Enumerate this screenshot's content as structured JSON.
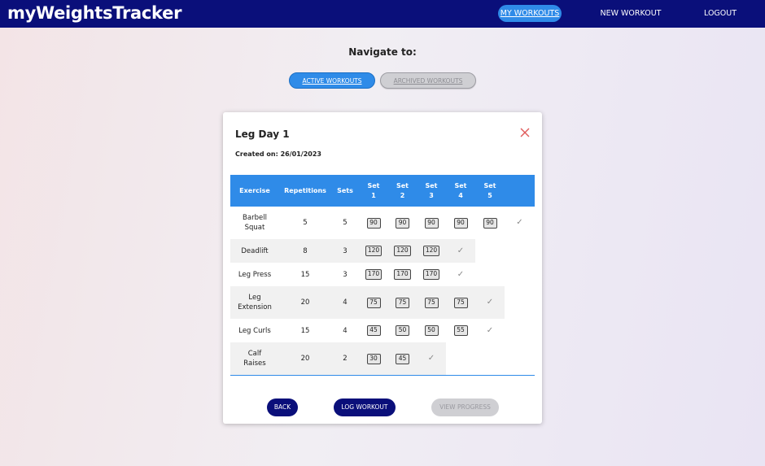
{
  "navbar": {
    "brand": "myWeightsTracker",
    "links": [
      "MY WORKOUTS",
      "NEW WORKOUT",
      "LOGOUT"
    ]
  },
  "navigate": {
    "title": "Navigate to:",
    "active_label": "ACTIVE WORKOUTS",
    "archived_label": "ARCHIVED WORKOUTS"
  },
  "workout": {
    "title": "Leg Day 1",
    "created_label": "Created on:",
    "created_date": "26/01/2023",
    "headers": [
      "Exercise",
      "Repetitions",
      "Sets",
      "Set\n1",
      "Set\n2",
      "Set\n3",
      "Set\n4",
      "Set\n5"
    ],
    "rows": [
      {
        "exercise": "Barbell Squat",
        "reps": "5",
        "sets": "5",
        "weights": [
          "90",
          "90",
          "90",
          "90",
          "90"
        ]
      },
      {
        "exercise": "Deadlift",
        "reps": "8",
        "sets": "3",
        "weights": [
          "120",
          "120",
          "120"
        ]
      },
      {
        "exercise": "Leg Press",
        "reps": "15",
        "sets": "3",
        "weights": [
          "170",
          "170",
          "170"
        ]
      },
      {
        "exercise": "Leg Extension",
        "reps": "20",
        "sets": "4",
        "weights": [
          "75",
          "75",
          "75",
          "75"
        ]
      },
      {
        "exercise": "Leg Curls",
        "reps": "15",
        "sets": "4",
        "weights": [
          "45",
          "50",
          "50",
          "55"
        ]
      },
      {
        "exercise": "Calf Raises",
        "reps": "20",
        "sets": "2",
        "weights": [
          "30",
          "45"
        ]
      }
    ],
    "check_glyph": "✓"
  },
  "actions": {
    "back": "BACK",
    "log": "LOG WORKOUT",
    "progress": "VIEW PROGRESS"
  },
  "colors": {
    "navy": "#0a0f7a",
    "accent": "#2f8be8",
    "close": "#e05a5a"
  }
}
